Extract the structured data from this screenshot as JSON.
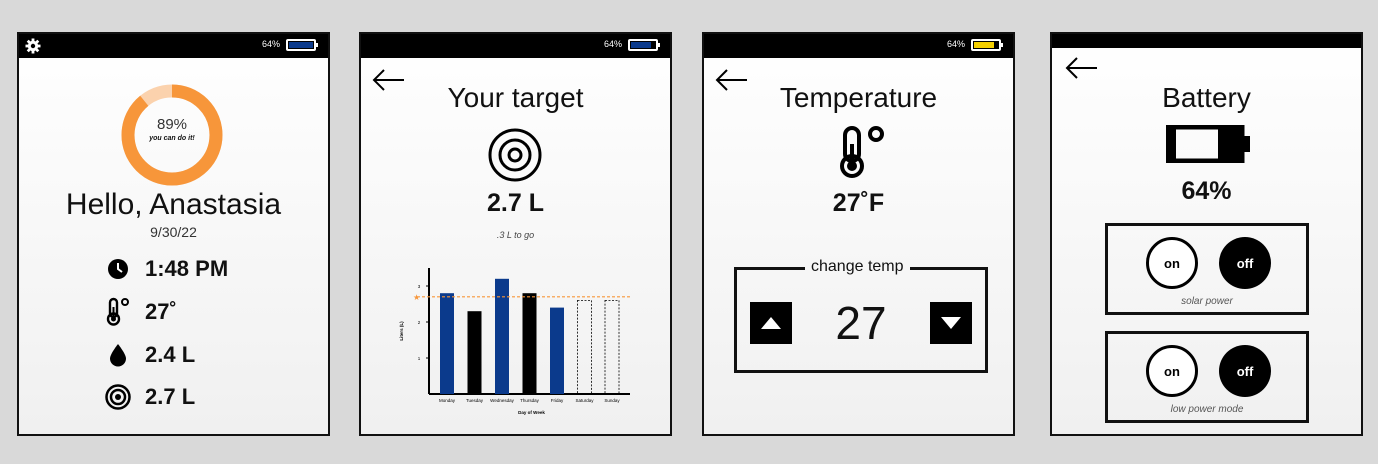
{
  "status": {
    "battery_text": "64%",
    "battery_level": 0.64
  },
  "colors": {
    "accent": "#f7963a",
    "accent_light": "#fbd2ad",
    "bar_blue": "#0b3a8c",
    "battery_yellow": "#f5d000"
  },
  "home": {
    "progress_percent_text": "89%",
    "progress_value": 0.89,
    "progress_caption": "you can do it!",
    "greeting": "Hello, Anastasia",
    "date": "9/30/22",
    "stats": [
      {
        "icon": "clock-icon",
        "value": "1:48 PM"
      },
      {
        "icon": "thermometer-icon",
        "value": "27˚"
      },
      {
        "icon": "water-drop-icon",
        "value": "2.4 L"
      },
      {
        "icon": "target-icon",
        "value": "2.7 L"
      }
    ]
  },
  "target": {
    "title": "Your target",
    "value": "2.7 L",
    "remaining": ".3 L to go"
  },
  "chart_data": {
    "type": "bar",
    "categories": [
      "Monday",
      "Tuesday",
      "Wednesday",
      "Thursday",
      "Friday",
      "Saturday",
      "Sunday"
    ],
    "values": [
      2.8,
      2.3,
      3.2,
      2.8,
      2.4,
      2.6,
      2.6
    ],
    "projected": [
      false,
      false,
      false,
      false,
      false,
      true,
      true
    ],
    "target_line": 2.7,
    "xlabel": "Day of Week",
    "ylabel": "Liters (L)",
    "y_ticks": [
      "1",
      "2",
      "3"
    ],
    "ylim": [
      0,
      3.5
    ],
    "grid": false
  },
  "temperature": {
    "title": "Temperature",
    "current": "27˚F",
    "change_label": "change temp",
    "setpoint": "27"
  },
  "battery": {
    "title": "Battery",
    "percent": "64%",
    "solar": {
      "on_label": "on",
      "off_label": "off",
      "caption": "solar power"
    },
    "low_power": {
      "on_label": "on",
      "off_label": "off",
      "caption": "low power mode"
    }
  }
}
